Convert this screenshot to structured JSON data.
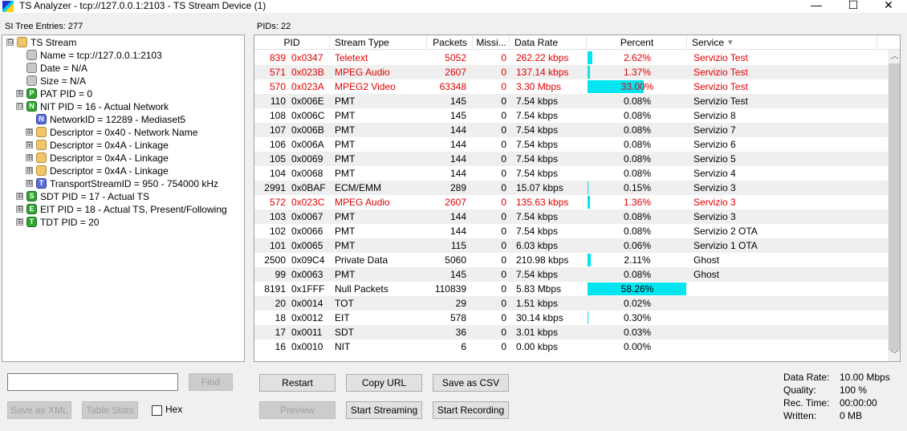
{
  "window": {
    "title": "TS Analyzer - tcp://127.0.0.1:2103 - TS Stream Device (1)",
    "minimize": "—",
    "maximize": "☐",
    "close": "✕"
  },
  "si_tree": {
    "label": "SI Tree Entries: 277",
    "nodes": [
      {
        "text": "TS Stream",
        "icon": "folder-icon",
        "letter": "",
        "expander": "⊟"
      },
      {
        "text": "Name = tcp://127.0.0.1:2103",
        "icon": "file-icon",
        "letter": "",
        "expander": ""
      },
      {
        "text": "Date = N/A",
        "icon": "file-icon",
        "letter": "",
        "expander": ""
      },
      {
        "text": "Size = N/A",
        "icon": "file-icon",
        "letter": "",
        "expander": ""
      },
      {
        "text": "PAT PID = 0",
        "icon": "pat-icon",
        "letter": "P",
        "expander": "⊞"
      },
      {
        "text": "NIT PID = 16 - Actual Network",
        "icon": "nit-icon",
        "letter": "N",
        "expander": "⊟"
      },
      {
        "text": "NetworkID = 12289 - Mediaset5",
        "icon": "network-id-icon",
        "letter": "N",
        "expander": ""
      },
      {
        "text": "Descriptor = 0x40 - Network Name",
        "icon": "folder-icon",
        "letter": "",
        "expander": "⊞"
      },
      {
        "text": "Descriptor = 0x4A - Linkage",
        "icon": "folder-icon",
        "letter": "",
        "expander": "⊞"
      },
      {
        "text": "Descriptor = 0x4A - Linkage",
        "icon": "folder-icon",
        "letter": "",
        "expander": "⊞"
      },
      {
        "text": "Descriptor = 0x4A - Linkage",
        "icon": "folder-icon",
        "letter": "",
        "expander": "⊞"
      },
      {
        "text": "TransportStreamID = 950 - 754000 kHz",
        "icon": "transport-stream-icon",
        "letter": "T",
        "expander": "⊞"
      },
      {
        "text": "SDT PID = 17 - Actual TS",
        "icon": "sdt-icon",
        "letter": "S",
        "expander": "⊞"
      },
      {
        "text": "EIT PID = 18 - Actual TS, Present/Following",
        "icon": "eit-icon",
        "letter": "E",
        "expander": "⊞"
      },
      {
        "text": "TDT PID = 20",
        "icon": "tdt-icon",
        "letter": "T",
        "expander": "⊞"
      }
    ]
  },
  "pids": {
    "label": "PIDs: 22",
    "columns": [
      "PID",
      "Stream Type",
      "Packets",
      "Missi...",
      "Data Rate",
      "Percent",
      "Service"
    ],
    "sort_icon": "▾",
    "rows": [
      {
        "pid_dec": "839",
        "pid_hex": "0x0347",
        "type": "Teletext",
        "packets": "5052",
        "missing": "0",
        "rate": "262.22 kbps",
        "pct_text": "2.62%",
        "pct": 2.62,
        "service": "Servizio Test",
        "red": true
      },
      {
        "pid_dec": "571",
        "pid_hex": "0x023B",
        "type": "MPEG Audio",
        "packets": "2607",
        "missing": "0",
        "rate": "137.14 kbps",
        "pct_text": "1.37%",
        "pct": 1.37,
        "service": "Servizio Test",
        "red": true
      },
      {
        "pid_dec": "570",
        "pid_hex": "0x023A",
        "type": "MPEG2 Video",
        "packets": "63348",
        "missing": "0",
        "rate": "3.30 Mbps",
        "pct_text": "33.00%",
        "pct": 33.0,
        "service": "Servizio Test",
        "red": true
      },
      {
        "pid_dec": "110",
        "pid_hex": "0x006E",
        "type": "PMT",
        "packets": "145",
        "missing": "0",
        "rate": "7.54 kbps",
        "pct_text": "0.08%",
        "pct": 0.08,
        "service": "Servizio Test",
        "red": false
      },
      {
        "pid_dec": "108",
        "pid_hex": "0x006C",
        "type": "PMT",
        "packets": "145",
        "missing": "0",
        "rate": "7.54 kbps",
        "pct_text": "0.08%",
        "pct": 0.08,
        "service": "Servizio 8",
        "red": false
      },
      {
        "pid_dec": "107",
        "pid_hex": "0x006B",
        "type": "PMT",
        "packets": "144",
        "missing": "0",
        "rate": "7.54 kbps",
        "pct_text": "0.08%",
        "pct": 0.08,
        "service": "Servizio 7",
        "red": false
      },
      {
        "pid_dec": "106",
        "pid_hex": "0x006A",
        "type": "PMT",
        "packets": "144",
        "missing": "0",
        "rate": "7.54 kbps",
        "pct_text": "0.08%",
        "pct": 0.08,
        "service": "Servizio 6",
        "red": false
      },
      {
        "pid_dec": "105",
        "pid_hex": "0x0069",
        "type": "PMT",
        "packets": "144",
        "missing": "0",
        "rate": "7.54 kbps",
        "pct_text": "0.08%",
        "pct": 0.08,
        "service": "Servizio 5",
        "red": false
      },
      {
        "pid_dec": "104",
        "pid_hex": "0x0068",
        "type": "PMT",
        "packets": "144",
        "missing": "0",
        "rate": "7.54 kbps",
        "pct_text": "0.08%",
        "pct": 0.08,
        "service": "Servizio 4",
        "red": false
      },
      {
        "pid_dec": "2991",
        "pid_hex": "0x0BAF",
        "type": "ECM/EMM",
        "packets": "289",
        "missing": "0",
        "rate": "15.07 kbps",
        "pct_text": "0.15%",
        "pct": 0.15,
        "service": "Servizio 3",
        "red": false
      },
      {
        "pid_dec": "572",
        "pid_hex": "0x023C",
        "type": "MPEG Audio",
        "packets": "2607",
        "missing": "0",
        "rate": "135.63 kbps",
        "pct_text": "1.36%",
        "pct": 1.36,
        "service": "Servizio 3",
        "red": true
      },
      {
        "pid_dec": "103",
        "pid_hex": "0x0067",
        "type": "PMT",
        "packets": "144",
        "missing": "0",
        "rate": "7.54 kbps",
        "pct_text": "0.08%",
        "pct": 0.08,
        "service": "Servizio 3",
        "red": false
      },
      {
        "pid_dec": "102",
        "pid_hex": "0x0066",
        "type": "PMT",
        "packets": "144",
        "missing": "0",
        "rate": "7.54 kbps",
        "pct_text": "0.08%",
        "pct": 0.08,
        "service": "Servizio 2 OTA",
        "red": false
      },
      {
        "pid_dec": "101",
        "pid_hex": "0x0065",
        "type": "PMT",
        "packets": "115",
        "missing": "0",
        "rate": "6.03 kbps",
        "pct_text": "0.06%",
        "pct": 0.06,
        "service": "Servizio 1 OTA",
        "red": false
      },
      {
        "pid_dec": "2500",
        "pid_hex": "0x09C4",
        "type": "Private Data",
        "packets": "5060",
        "missing": "0",
        "rate": "210.98 kbps",
        "pct_text": "2.11%",
        "pct": 2.11,
        "service": "Ghost",
        "red": false
      },
      {
        "pid_dec": "99",
        "pid_hex": "0x0063",
        "type": "PMT",
        "packets": "145",
        "missing": "0",
        "rate": "7.54 kbps",
        "pct_text": "0.08%",
        "pct": 0.08,
        "service": "Ghost",
        "red": false
      },
      {
        "pid_dec": "8191",
        "pid_hex": "0x1FFF",
        "type": "Null Packets",
        "packets": "110839",
        "missing": "0",
        "rate": "5.83 Mbps",
        "pct_text": "58.26%",
        "pct": 58.26,
        "service": "",
        "red": false
      },
      {
        "pid_dec": "20",
        "pid_hex": "0x0014",
        "type": "TOT",
        "packets": "29",
        "missing": "0",
        "rate": "1.51 kbps",
        "pct_text": "0.02%",
        "pct": 0.02,
        "service": "",
        "red": false
      },
      {
        "pid_dec": "18",
        "pid_hex": "0x0012",
        "type": "EIT",
        "packets": "578",
        "missing": "0",
        "rate": "30.14 kbps",
        "pct_text": "0.30%",
        "pct": 0.3,
        "service": "",
        "red": false
      },
      {
        "pid_dec": "17",
        "pid_hex": "0x0011",
        "type": "SDT",
        "packets": "36",
        "missing": "0",
        "rate": "3.01 kbps",
        "pct_text": "0.03%",
        "pct": 0.03,
        "service": "",
        "red": false
      },
      {
        "pid_dec": "16",
        "pid_hex": "0x0010",
        "type": "NIT",
        "packets": "6",
        "missing": "0",
        "rate": "0.00 kbps",
        "pct_text": "0.00%",
        "pct": 0.0,
        "service": "",
        "red": false
      }
    ]
  },
  "left_controls": {
    "search_value": "",
    "find": "Find",
    "save_xml": "Save as XML",
    "table_stats": "Table Stats",
    "hex": "Hex"
  },
  "buttons": {
    "restart": "Restart",
    "copy_url": "Copy URL",
    "save_csv": "Save as CSV",
    "preview": "Preview",
    "start_streaming": "Start Streaming",
    "start_recording": "Start Recording"
  },
  "stats": {
    "data_rate_label": "Data Rate:",
    "data_rate": "10.00 Mbps",
    "quality_label": "Quality:",
    "quality": "100 %",
    "rec_time_label": "Rec. Time:",
    "rec_time": "00:00:00",
    "written_label": "Written:",
    "written": "0 MB"
  },
  "colors": {
    "accent_bar": "#00e5f0",
    "highlight_text": "#e00000"
  }
}
